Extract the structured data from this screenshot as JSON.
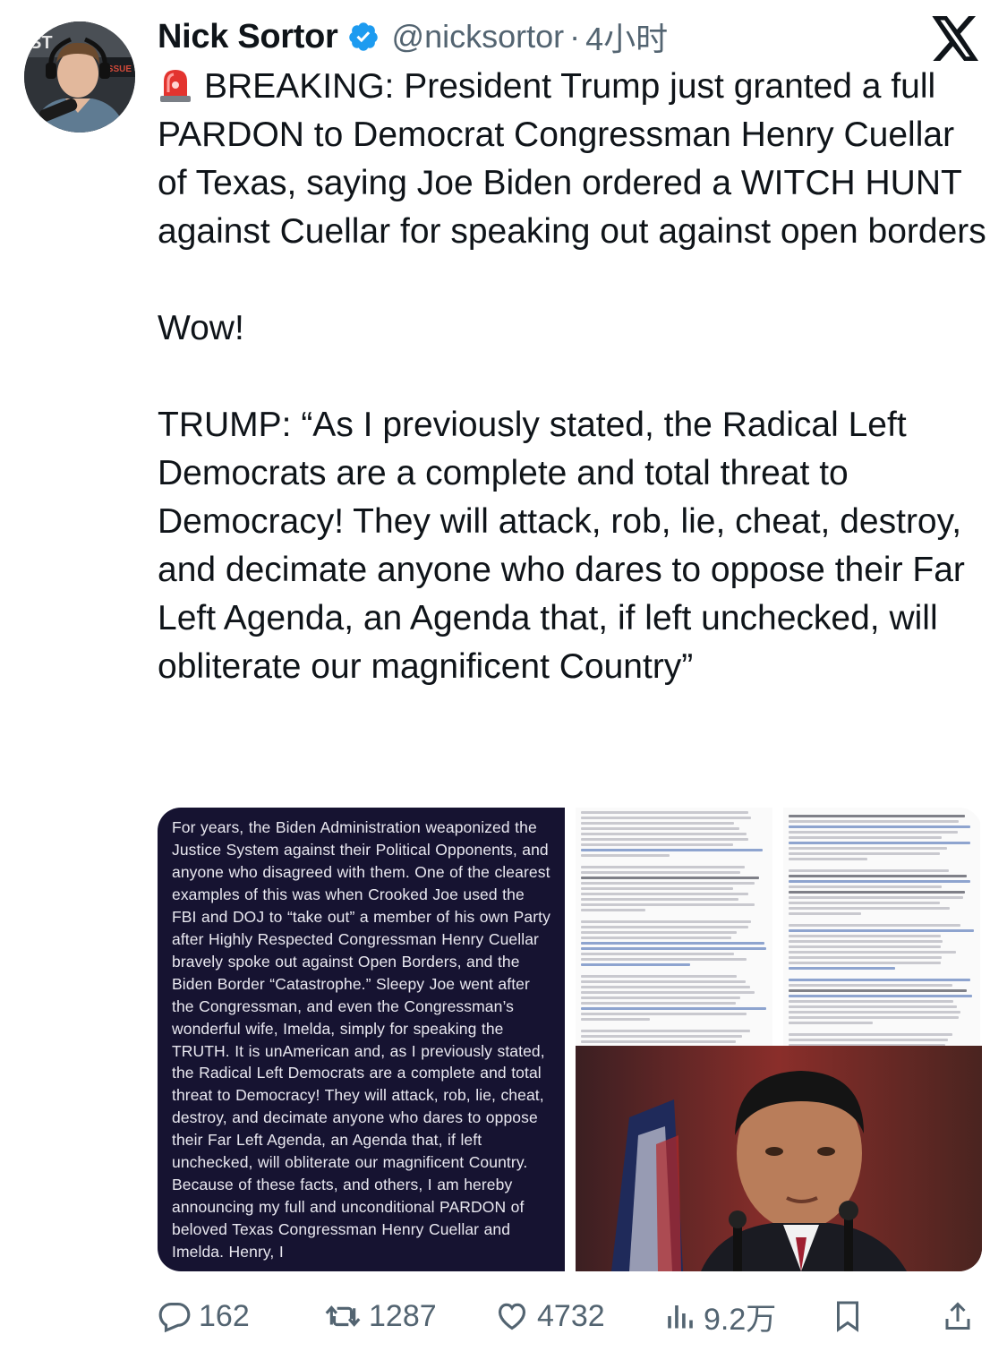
{
  "author": {
    "name": "Nick Sortor",
    "handle": "@nicksortor",
    "separator": "·",
    "time": "4小时",
    "avatar_text_1": "ST",
    "avatar_text_2": "ISSUE"
  },
  "tweet": {
    "siren_icon": "siren-emoji-icon",
    "body": "BREAKING: President Trump just granted a full PARDON to Democrat Congressman Henry Cuellar of Texas, saying Joe Biden ordered a WITCH HUNT against Cuellar for speaking out against open borders\n\nWow!\n\nTRUMP: “As I previously stated, the Radical Left Democrats are a complete and total threat to Democracy! They will attack, rob, lie, cheat, destroy, and decimate anyone who dares to oppose their Far Left Agenda, an Agenda that, if left unchecked, will obliterate our magnificent Country”"
  },
  "media": {
    "statement": "For years, the Biden Administration weaponized the Justice System against their Political Opponents, and anyone who disagreed with them. One of the clearest examples of this was when Crooked Joe used the FBI and DOJ to “take out” a member of his own Party after Highly Respected Congressman Henry Cuellar bravely spoke out against Open Borders, and the Biden Border “Catastrophe.” Sleepy Joe went after the Congressman, and even the Congressman’s wonderful wife, Imelda, simply for speaking the TRUTH. It is unAmerican and, as I previously stated, the Radical Left Democrats are a complete and total threat to Democracy! They will attack, rob, lie, cheat, destroy, and decimate anyone who dares to oppose their Far Left Agenda, an Agenda that, if left unchecked, will obliterate our magnificent Country. Because of these facts, and others, I am hereby announcing my full and unconditional PARDON of beloved Texas Congressman Henry Cuellar and Imelda. Henry, I"
  },
  "actions": {
    "replies": "162",
    "reposts": "1287",
    "likes": "4732",
    "views": "9.2万"
  },
  "colors": {
    "text": "#0f1419",
    "muted": "#536471",
    "verified": "#1d9bf0",
    "statement_bg": "#161331"
  }
}
